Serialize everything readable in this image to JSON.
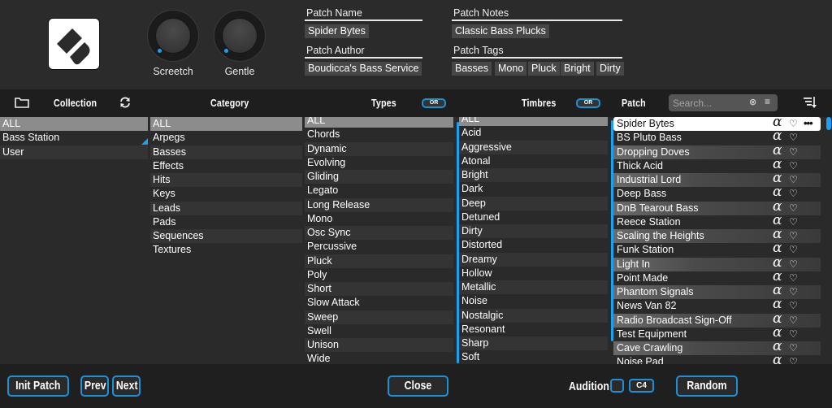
{
  "knobs": [
    {
      "label": "Screetch",
      "value": 0
    },
    {
      "label": "Gentle",
      "value": 0
    }
  ],
  "patch_info": {
    "name_label": "Patch Name",
    "name_value": "Spider Bytes",
    "author_label": "Patch Author",
    "author_value": "Boudicca's Bass Service",
    "notes_label": "Patch Notes",
    "notes_value": "Classic Bass Plucks",
    "tags_label": "Patch Tags",
    "tags": [
      "Basses",
      "Mono",
      "Pluck",
      "Bright",
      "Dirty"
    ]
  },
  "headers": {
    "collection": "Collection",
    "category": "Category",
    "types": "Types",
    "types_mode": "OR",
    "timbres": "Timbres",
    "timbres_mode": "OR",
    "patch": "Patch",
    "search_placeholder": "Search..."
  },
  "collection": {
    "items": [
      "ALL",
      "Bass Station",
      "User"
    ],
    "selected": "ALL"
  },
  "category": {
    "items": [
      "ALL",
      "Arpegs",
      "Basses",
      "Effects",
      "Hits",
      "Keys",
      "Leads",
      "Pads",
      "Sequences",
      "Textures"
    ],
    "selected": "ALL"
  },
  "types": {
    "items": [
      "ALL",
      "Chords",
      "Dynamic",
      "Evolving",
      "Gliding",
      "Legato",
      "Long Release",
      "Mono",
      "Osc Sync",
      "Percussive",
      "Pluck",
      "Poly",
      "Short",
      "Slow Attack",
      "Sweep",
      "Swell",
      "Unison",
      "Wide"
    ],
    "selected": "ALL"
  },
  "timbres": {
    "items": [
      "ALL",
      "Acid",
      "Aggressive",
      "Atonal",
      "Bright",
      "Dark",
      "Deep",
      "Detuned",
      "Dirty",
      "Distorted",
      "Dreamy",
      "Hollow",
      "Metallic",
      "Noise",
      "Nostalgic",
      "Resonant",
      "Sharp",
      "Soft"
    ],
    "selected": "ALL"
  },
  "patches": {
    "items": [
      "Spider Bytes",
      "BS Pluto Bass",
      "Dropping Doves",
      "Thick Acid",
      "Industrial Lord",
      "Deep Bass",
      "DnB Tearout Bass",
      "Reece Station",
      "Scaling the Heights",
      "Funk Station",
      "Light In",
      "Point Made",
      "Phantom Signals",
      "News Van 82",
      "Radio Broadcast Sign-Off",
      "Test Equipment",
      "Cave Crawling",
      "Noise Pad"
    ],
    "selected": "Spider Bytes",
    "alpha_glyph": "α",
    "heart_glyph": "♡",
    "more_glyph": "•••"
  },
  "footer": {
    "init_patch": "Init Patch",
    "prev": "Prev",
    "next": "Next",
    "close": "Close",
    "audition": "Audition",
    "audition_checked": false,
    "note": "C4",
    "random": "Random"
  },
  "colors": {
    "accent": "#1ea0f0",
    "background": "#2b2b2b",
    "selected_row": "#8c8c8c"
  }
}
